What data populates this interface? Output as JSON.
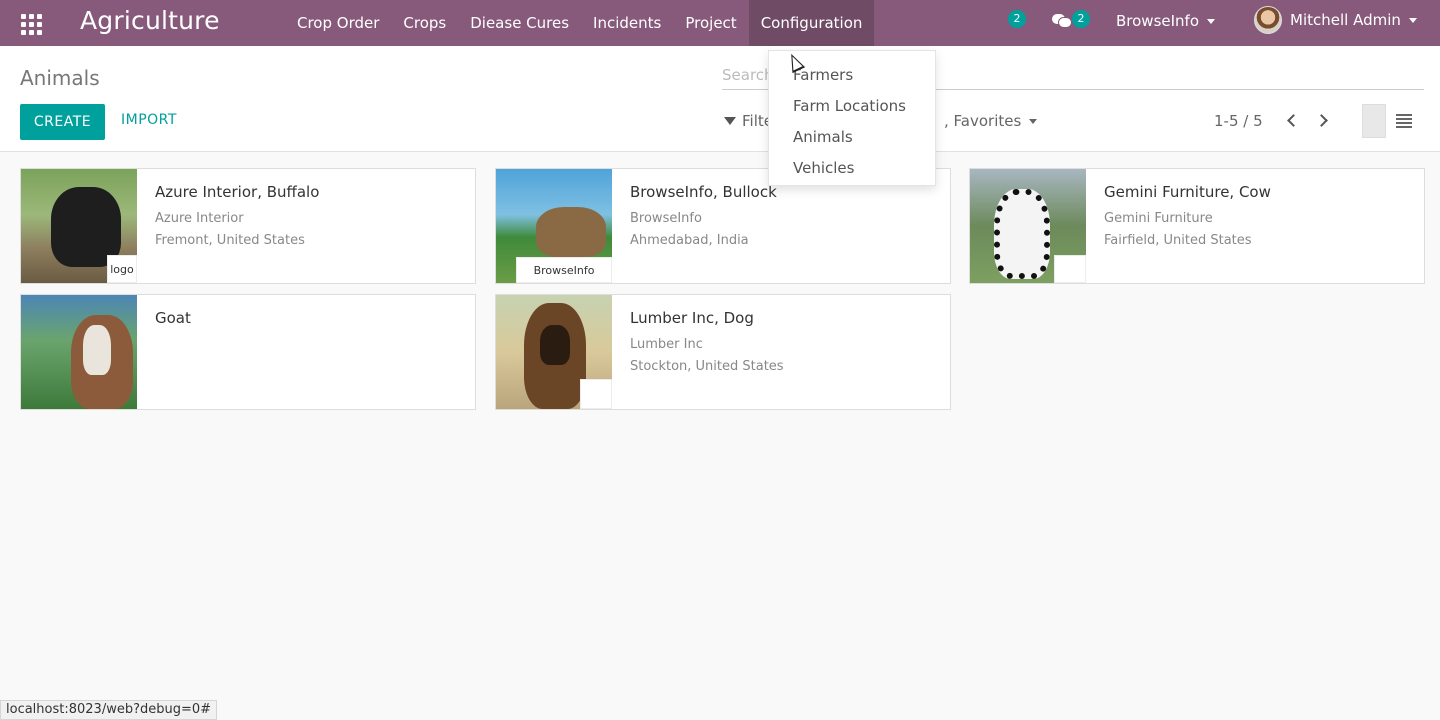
{
  "navbar": {
    "brand": "Agriculture",
    "menu": [
      {
        "label": "Crop Order"
      },
      {
        "label": "Crops"
      },
      {
        "label": "Diease Cures"
      },
      {
        "label": "Incidents"
      },
      {
        "label": "Project"
      },
      {
        "label": "Configuration",
        "active": true
      }
    ],
    "activity_count": "2",
    "messages_count": "2",
    "company": "BrowseInfo",
    "user": "Mitchell Admin"
  },
  "control_panel": {
    "breadcrumb": "Animals",
    "search_placeholder": "Search",
    "create_label": "CREATE",
    "import_label": "IMPORT",
    "filters_label": "Filte",
    "favorites_label": ", Favorites",
    "pager": "1-5 / 5"
  },
  "dropdown": {
    "items": [
      "Farmers",
      "Farm Locations",
      "Animals",
      "Vehicles"
    ]
  },
  "cards": [
    {
      "title": "Azure Interior, Buffalo",
      "company": "Azure Interior",
      "location": "Fremont, United States",
      "logo": "logo"
    },
    {
      "title": "BrowseInfo, Bullock",
      "company": "BrowseInfo",
      "location": "Ahmedabad, India",
      "logo": "BrowseInfo"
    },
    {
      "title": "Gemini Furniture, Cow",
      "company": "Gemini Furniture",
      "location": "Fairfield, United States",
      "logo": ""
    },
    {
      "title": "Goat",
      "company": "",
      "location": "",
      "logo": ""
    },
    {
      "title": "Lumber Inc, Dog",
      "company": "Lumber Inc",
      "location": "Stockton, United States",
      "logo": ""
    }
  ],
  "statusbar": "localhost:8023/web?debug=0#",
  "colors": {
    "navbar": "#875a7b",
    "accent": "#00a09d"
  }
}
